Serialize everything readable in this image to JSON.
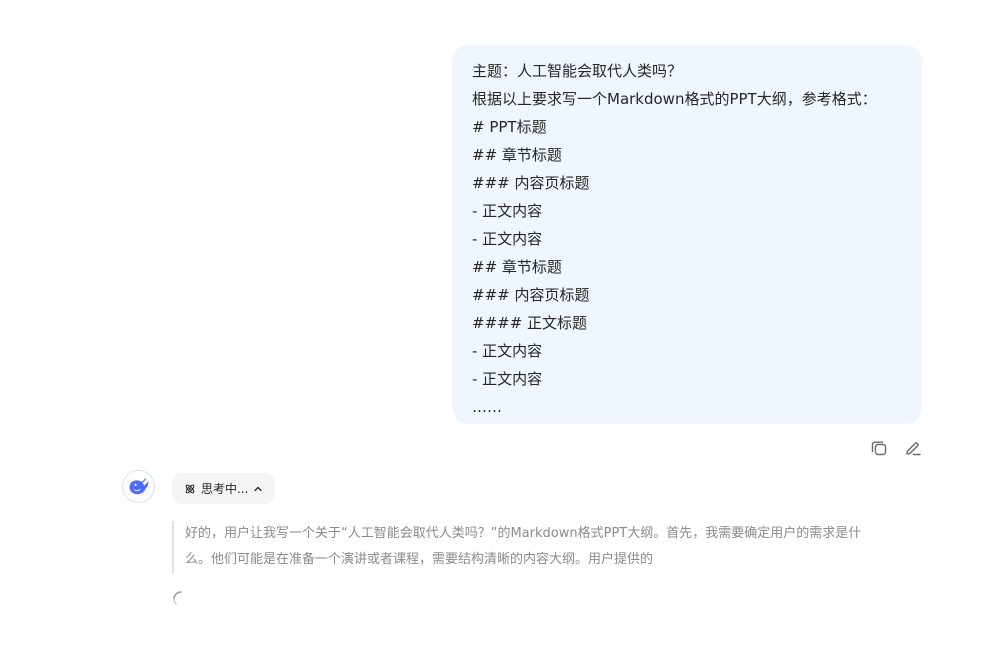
{
  "user_message": {
    "lines": [
      "主题：人工智能会取代人类吗？",
      "根据以上要求写一个Markdown格式的PPT大纲，参考格式：",
      "# PPT标题",
      "## 章节标题",
      "### 内容页标题",
      "- 正文内容",
      "- 正文内容",
      "## 章节标题",
      "### 内容页标题",
      "#### 正文标题",
      "- 正文内容",
      "- 正文内容",
      "……"
    ]
  },
  "message_actions": {
    "copy_icon": "copy-icon",
    "edit_icon": "edit-icon"
  },
  "assistant": {
    "avatar_icon": "whale-logo-icon",
    "avatar_color": "#4d6bfe",
    "thinking_chip": {
      "label": "思考中...",
      "icon": "atom-icon",
      "toggle_icon": "chevron-up-icon"
    },
    "thinking_text": [
      "好的，用户让我写一个关于“人工智能会取代人类吗？”的Markdown格式PPT大纲。首先，我需要确定用户的需求是什",
      "么。他们可能是在准备一个演讲或者课程，需要结构清晰的内容大纲。用户提供的"
    ],
    "loading_icon": "spinner-icon"
  }
}
